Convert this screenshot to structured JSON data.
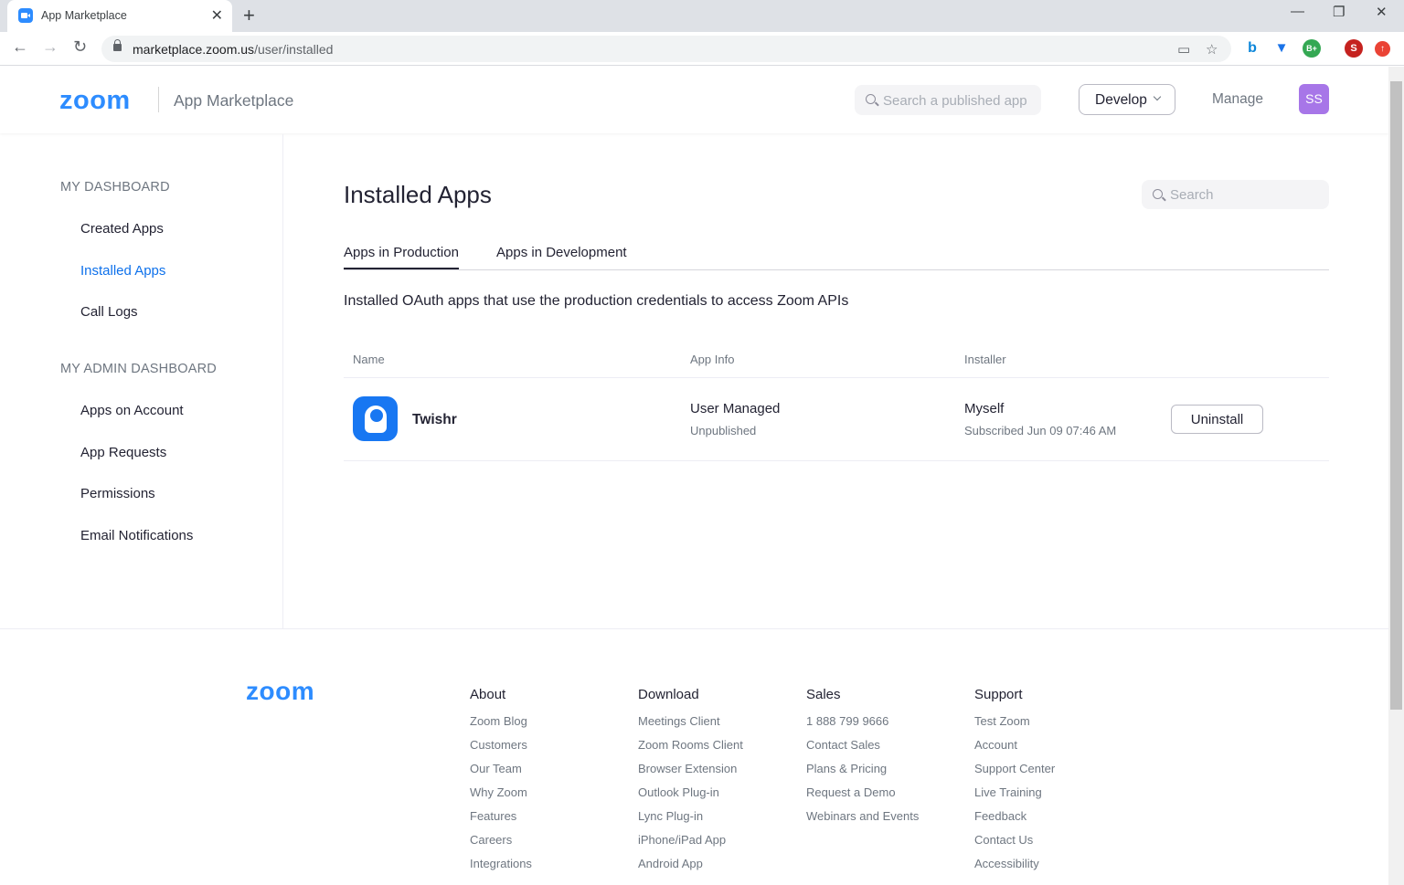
{
  "browser": {
    "tab_title": "App Marketplace",
    "url_host": "marketplace.zoom.us",
    "url_path": "/user/installed",
    "profile_initial": "S",
    "ext_badge": "B+"
  },
  "header": {
    "logo": "zoom",
    "subtitle": "App Marketplace",
    "search_placeholder": "Search a published app",
    "develop_label": "Develop",
    "manage_label": "Manage",
    "avatar_initials": "SS"
  },
  "sidebar": {
    "dashboard_heading": "MY DASHBOARD",
    "dashboard_items": [
      "Created Apps",
      "Installed Apps",
      "Call Logs"
    ],
    "admin_heading": "MY ADMIN DASHBOARD",
    "admin_items": [
      "Apps on Account",
      "App Requests",
      "Permissions",
      "Email Notifications"
    ]
  },
  "main": {
    "title": "Installed Apps",
    "search_placeholder": "Search",
    "tabs": [
      "Apps in Production",
      "Apps in Development"
    ],
    "description": "Installed OAuth apps that use the production credentials to access Zoom APIs",
    "columns": [
      "Name",
      "App Info",
      "Installer"
    ],
    "rows": [
      {
        "name": "Twishr",
        "app_info": "User Managed",
        "app_status": "Unpublished",
        "installer": "Myself",
        "subscribed": "Subscribed Jun 09 07:46 AM",
        "action": "Uninstall"
      }
    ]
  },
  "footer": {
    "logo": "zoom",
    "about": {
      "heading": "About",
      "links": [
        "Zoom Blog",
        "Customers",
        "Our Team",
        "Why Zoom",
        "Features",
        "Careers",
        "Integrations"
      ]
    },
    "download": {
      "heading": "Download",
      "links": [
        "Meetings Client",
        "Zoom Rooms Client",
        "Browser Extension",
        "Outlook Plug-in",
        "Lync Plug-in",
        "iPhone/iPad App",
        "Android App"
      ]
    },
    "sales": {
      "heading": "Sales",
      "links": [
        "1 888 799 9666",
        "Contact Sales",
        "Plans & Pricing",
        "Request a Demo",
        "Webinars and Events"
      ]
    },
    "support": {
      "heading": "Support",
      "links": [
        "Test Zoom",
        "Account",
        "Support Center",
        "Live Training",
        "Feedback",
        "Contact Us",
        "Accessibility"
      ]
    }
  },
  "colors": {
    "brand": "#2d8cff",
    "active_link": "#0e71eb",
    "avatar_bg": "#a776e8",
    "app_icon_bg": "#1877f2"
  }
}
